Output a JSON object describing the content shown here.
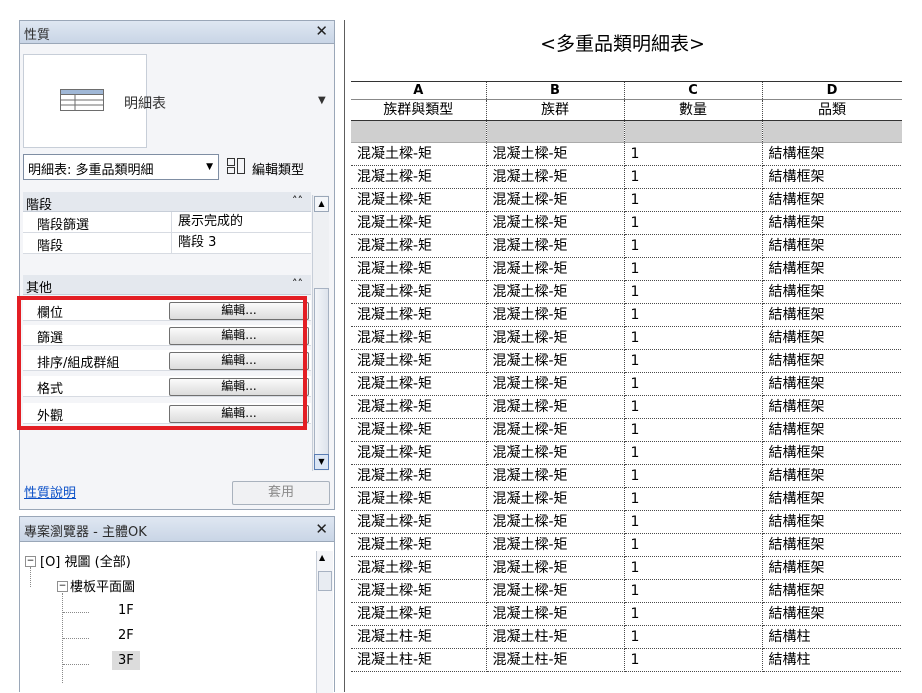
{
  "properties": {
    "panel_title": "性質",
    "close": "✕",
    "type_name": "明細表",
    "instance_selector": "明細表: 多重品類明細",
    "edit_type_label": "編輯類型",
    "groups": [
      {
        "title": "階段",
        "collapse": "˄˄",
        "rows": [
          {
            "key": "階段篩選",
            "value": "展示完成的"
          },
          {
            "key": "階段",
            "value": "階段 3"
          }
        ]
      },
      {
        "title": "其他",
        "collapse": "˄˄",
        "rows": [
          {
            "key": "欄位",
            "value": "編輯..."
          },
          {
            "key": "篩選",
            "value": "編輯..."
          },
          {
            "key": "排序/組成群組",
            "value": "編輯..."
          },
          {
            "key": "格式",
            "value": "編輯..."
          },
          {
            "key": "外觀",
            "value": "編輯..."
          }
        ]
      }
    ],
    "help_link": "性質說明",
    "apply_button": "套用"
  },
  "project_browser": {
    "title": "專案瀏覽器 - 主體OK",
    "close": "✕",
    "tree": [
      {
        "label": "[O] 視圖 (全部)",
        "expander": "−"
      },
      {
        "label": "樓板平面圖",
        "expander": "−"
      },
      {
        "label": "1F"
      },
      {
        "label": "2F"
      },
      {
        "label": "3F"
      }
    ]
  },
  "schedule": {
    "title": "<多重品類明細表>",
    "column_letters": [
      "A",
      "B",
      "C",
      "D"
    ],
    "column_headers": [
      "族群與類型",
      "族群",
      "數量",
      "品類"
    ],
    "rows": [
      [
        "混凝土樑-矩",
        "混凝土樑-矩",
        "1",
        "結構框架"
      ],
      [
        "混凝土樑-矩",
        "混凝土樑-矩",
        "1",
        "結構框架"
      ],
      [
        "混凝土樑-矩",
        "混凝土樑-矩",
        "1",
        "結構框架"
      ],
      [
        "混凝土樑-矩",
        "混凝土樑-矩",
        "1",
        "結構框架"
      ],
      [
        "混凝土樑-矩",
        "混凝土樑-矩",
        "1",
        "結構框架"
      ],
      [
        "混凝土樑-矩",
        "混凝土樑-矩",
        "1",
        "結構框架"
      ],
      [
        "混凝土樑-矩",
        "混凝土樑-矩",
        "1",
        "結構框架"
      ],
      [
        "混凝土樑-矩",
        "混凝土樑-矩",
        "1",
        "結構框架"
      ],
      [
        "混凝土樑-矩",
        "混凝土樑-矩",
        "1",
        "結構框架"
      ],
      [
        "混凝土樑-矩",
        "混凝土樑-矩",
        "1",
        "結構框架"
      ],
      [
        "混凝土樑-矩",
        "混凝土樑-矩",
        "1",
        "結構框架"
      ],
      [
        "混凝土樑-矩",
        "混凝土樑-矩",
        "1",
        "結構框架"
      ],
      [
        "混凝土樑-矩",
        "混凝土樑-矩",
        "1",
        "結構框架"
      ],
      [
        "混凝土樑-矩",
        "混凝土樑-矩",
        "1",
        "結構框架"
      ],
      [
        "混凝土樑-矩",
        "混凝土樑-矩",
        "1",
        "結構框架"
      ],
      [
        "混凝土樑-矩",
        "混凝土樑-矩",
        "1",
        "結構框架"
      ],
      [
        "混凝土樑-矩",
        "混凝土樑-矩",
        "1",
        "結構框架"
      ],
      [
        "混凝土樑-矩",
        "混凝土樑-矩",
        "1",
        "結構框架"
      ],
      [
        "混凝土樑-矩",
        "混凝土樑-矩",
        "1",
        "結構框架"
      ],
      [
        "混凝土樑-矩",
        "混凝土樑-矩",
        "1",
        "結構框架"
      ],
      [
        "混凝土樑-矩",
        "混凝土樑-矩",
        "1",
        "結構框架"
      ],
      [
        "混凝土柱-矩",
        "混凝土柱-矩",
        "1",
        "結構柱"
      ],
      [
        "混凝土柱-矩",
        "混凝土柱-矩",
        "1",
        "結構柱"
      ]
    ]
  },
  "colors": {
    "highlight": "#e31e24",
    "link": "#0a50c8"
  }
}
